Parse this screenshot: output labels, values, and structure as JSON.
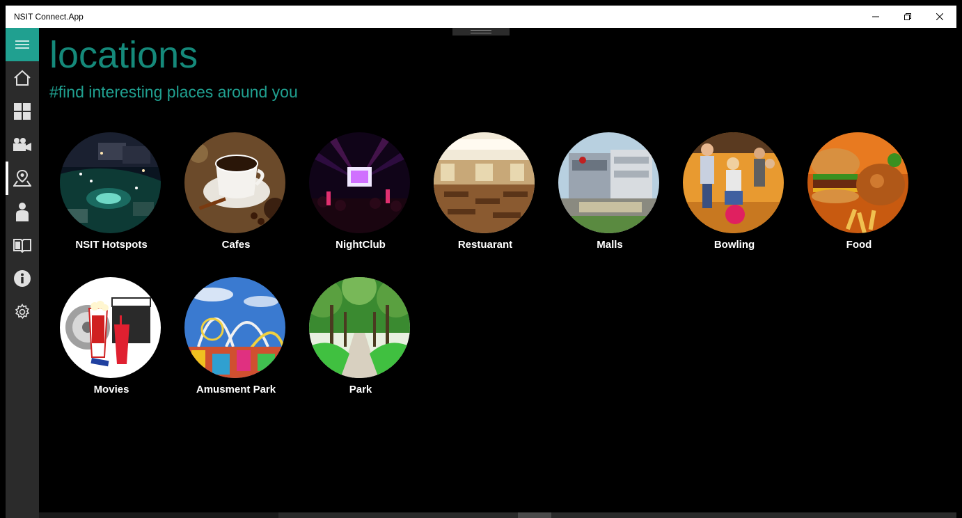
{
  "window": {
    "title": "NSIT Connect.App"
  },
  "page": {
    "heading": "locations",
    "subheading": "#find interesting places around you"
  },
  "sidebar": {
    "items": [
      {
        "name": "home",
        "icon": "home-icon"
      },
      {
        "name": "dashboard",
        "icon": "grid-icon"
      },
      {
        "name": "videos",
        "icon": "video-camera-icon"
      },
      {
        "name": "locations",
        "icon": "map-pin-icon",
        "selected": true
      },
      {
        "name": "profile",
        "icon": "person-icon"
      },
      {
        "name": "library",
        "icon": "book-icon"
      },
      {
        "name": "about",
        "icon": "info-icon"
      },
      {
        "name": "settings",
        "icon": "gear-icon"
      }
    ]
  },
  "locations": [
    {
      "label": "NSIT Hotspots"
    },
    {
      "label": "Cafes"
    },
    {
      "label": "NightClub"
    },
    {
      "label": "Restuarant"
    },
    {
      "label": "Malls"
    },
    {
      "label": "Bowling"
    },
    {
      "label": "Food"
    },
    {
      "label": "Movies"
    },
    {
      "label": "Amusment Park"
    },
    {
      "label": "Park"
    }
  ],
  "colors": {
    "accent": "#20a090",
    "heading": "#15897a",
    "sidebar": "#2b2b2b",
    "background": "#000000"
  }
}
